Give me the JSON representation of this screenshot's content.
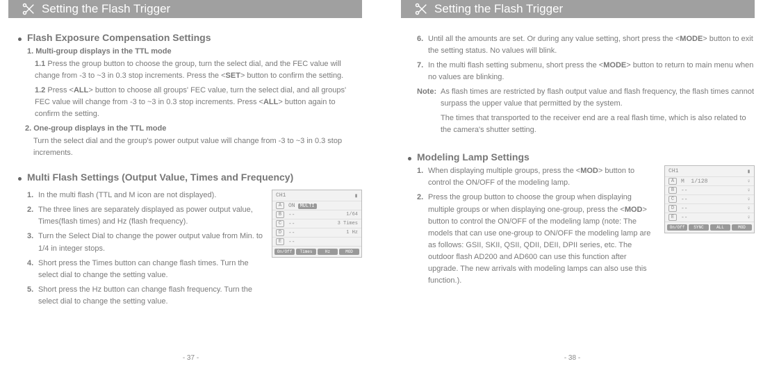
{
  "left": {
    "header": "Setting the Flash Trigger",
    "section1": {
      "title": "Flash Exposure Compensation Settings",
      "sub1": "1. Multi-group displays in the TTL mode",
      "e11_num": "1.1",
      "e11": " Press the group button to choose the group, turn the select dial, and the FEC value will change from -3 to ~3 in 0.3 stop increments. Press the <",
      "e11_b": "SET",
      "e11_after": "> button to confirm the setting.",
      "e12_num": "1.2",
      "e12a": " Press <",
      "e12a_b": "ALL",
      "e12b": "> button to choose all groups' FEC value, turn the select dial, and all groups' FEC value will change from -3 to ~3 in 0.3 stop increments. Press <",
      "e12b_b": "ALL",
      "e12c": "> button again to confirm the setting.",
      "sub2": "2. One-group displays in the TTL mode",
      "e2": "Turn the select dial and the group's power output value will change from -3 to ~3 in 0.3 stop increments."
    },
    "section2": {
      "title": "Multi Flash Settings (Output Value, Times and Frequency)",
      "s1n": "1.",
      "s1": " In the multi flash (TTL and M icon are not displayed).",
      "s2n": "2.",
      "s2": " The three lines are separately displayed as power output value, Times(flash times) and Hz (flash frequency).",
      "s3n": "3.",
      "s3": " Turn the Select Dial to change the power output value from Min. to 1/4 in integer stops.",
      "s4n": "4.",
      "s4": " Short press the Times button can change flash times. Turn the select dial to change the setting value.",
      "s5n": "5.",
      "s5": " Short press the Hz button can change flash frequency. Turn the select dial to change the setting value."
    },
    "lcd1": {
      "ch": "CH1",
      "rows": {
        "a": "A",
        "a_on": "ON",
        "a_tag": "MULTI",
        "b": "B",
        "b_v": "--",
        "b_r": "1/64",
        "c": "C",
        "c_v": "--",
        "c_r": "3 Times",
        "d": "D",
        "d_v": "--",
        "d_r": "1 Hz",
        "e": "E",
        "e_v": "--"
      },
      "btns": [
        "On/Off",
        "Times",
        "Hz",
        "MOD"
      ]
    },
    "pagenum": "- 37 -"
  },
  "right": {
    "header": "Setting the Flash Trigger",
    "cont": {
      "s6n": "6.",
      "s6a": " Until all the amounts are set. Or during any value setting, short press the <",
      "s6b": "MODE",
      "s6c": "> button to exit the setting status. No values will blink.",
      "s7n": "7.",
      "s7a": " In the multi flash setting submenu, short press the <",
      "s7b": "MODE",
      "s7c": "> button to return to main menu when no values are blinking.",
      "noteLabel": "Note:",
      "note": " As flash times are restricted by flash output value and flash frequency, the flash times cannot surpass the upper value that permitted by the system.",
      "note2": "The times that transported to the receiver end are a real flash time, which is also related to the camera's shutter setting."
    },
    "section3": {
      "title": "Modeling Lamp Settings",
      "s1n": "1.",
      "s1a": " When displaying multiple groups, press the <",
      "s1b": "MOD",
      "s1c": "> button to control the ON/OFF of the modeling lamp.",
      "s2n": "2.",
      "s2a": " Press the group button to choose the group when displaying multiple groups or when displaying one-group, press the <",
      "s2b": "MOD",
      "s2c": "> button to control the ON/OFF of the modeling lamp (note: The models that can use one-group to ON/OFF the modeling lamp are as follows: GSII, SKII, QSII, QDII, DEII, DPII series, etc. The outdoor flash AD200 and AD600 can use this function after upgrade. The new arrivals with modeling lamps can also use this function.)."
    },
    "lcd2": {
      "ch": "CH1",
      "rows": {
        "a": "A",
        "a_m": "M",
        "a_p": "1/128",
        "b": "B",
        "b_v": "--",
        "c": "C",
        "c_v": "--",
        "d": "D",
        "d_v": "--",
        "e": "E",
        "e_v": "--"
      },
      "btns": [
        "On/Off",
        "SYNC",
        "ALL",
        "MOD"
      ]
    },
    "pagenum": "- 38 -"
  }
}
